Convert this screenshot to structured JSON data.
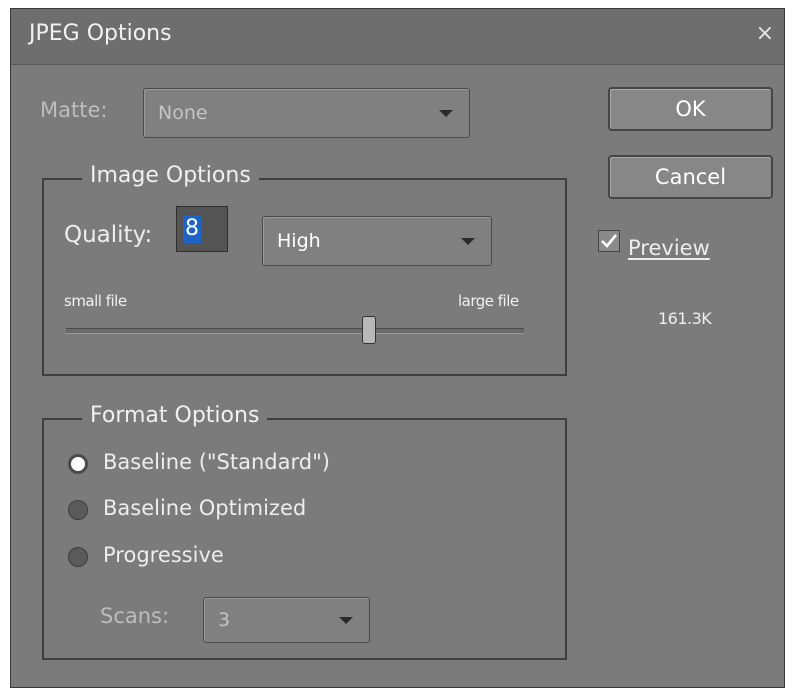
{
  "window": {
    "title": "JPEG Options",
    "close_glyph": "×"
  },
  "matte": {
    "label": "Matte:",
    "value": "None"
  },
  "image_options": {
    "legend": "Image Options",
    "quality_label": "Quality:",
    "quality_value": "8",
    "quality_preset": "High",
    "small_label": "small file",
    "large_label": "large file",
    "slider_quality": 8,
    "slider_max": 12
  },
  "format_options": {
    "legend": "Format Options",
    "options": [
      {
        "label": "Baseline (\"Standard\")",
        "selected": true
      },
      {
        "label": "Baseline Optimized",
        "selected": false
      },
      {
        "label": "Progressive",
        "selected": false
      }
    ],
    "scans_label": "Scans:",
    "scans_value": "3"
  },
  "buttons": {
    "ok": "OK",
    "cancel": "Cancel"
  },
  "preview": {
    "label": "Preview",
    "checked": true,
    "size": "161.3K"
  },
  "colors": {
    "dialog_bg": "#7b7b7b",
    "selection": "#1e63c8"
  }
}
